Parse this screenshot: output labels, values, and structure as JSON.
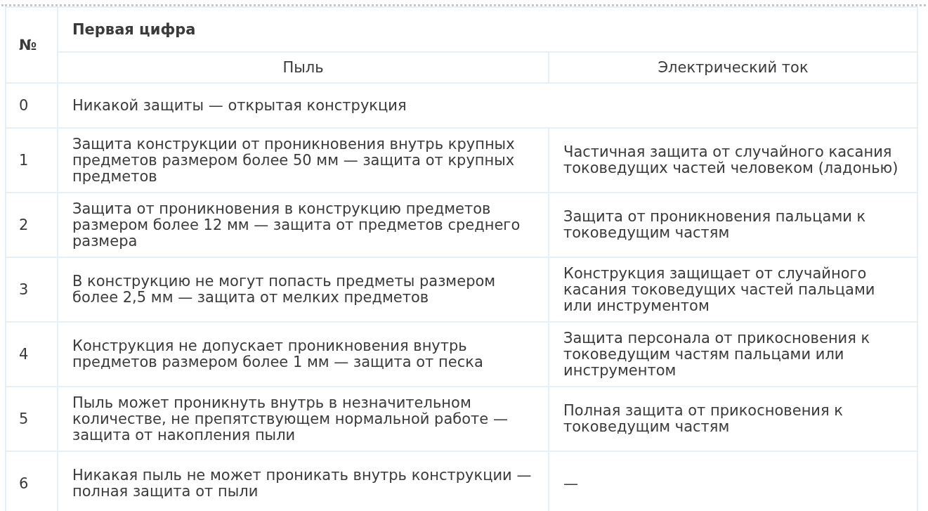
{
  "table": {
    "number_header": "№",
    "group_header": "Первая цифра",
    "columns": [
      "Пыль",
      "Электрический ток"
    ],
    "rows": [
      {
        "kind": "merged",
        "number": "0",
        "dust": "Никакой защиты — открытая конструкция"
      },
      {
        "kind": "split",
        "number": "1",
        "dust": "Защита конструкции от проникновения внутрь крупных предметов размером более 50 мм — защита от крупных предметов",
        "current": "Частичная защита от случайного касания токоведущих частей человеком (ладонью)"
      },
      {
        "kind": "split",
        "number": "2",
        "dust": "Защита от проникновения в конструкцию предметов размером более 12 мм — защита от предметов среднего размера",
        "current": "Защита от проникновения пальцами к токоведущим частям"
      },
      {
        "kind": "split",
        "number": "3",
        "dust": "В конструкцию не могут попасть предметы размером более 2,5 мм — защита от мелких предметов",
        "current": "Конструкция защищает от случайного касания токоведущих частей пальцами или инструментом"
      },
      {
        "kind": "split",
        "number": "4",
        "dust": "Конструкция не допускает проникновения внутрь предметов размером более 1 мм — защита от песка",
        "current": "Защита персонала от прикосновения к токоведущим частям пальцами или инструментом"
      },
      {
        "kind": "split",
        "number": "5",
        "dust": "Пыль может проникнуть внутрь в незначительном количестве, не препятствующем нормальной работе — защита от накопления пыли",
        "current": "Полная защита от прикосновения к токоведущим частям"
      },
      {
        "kind": "split",
        "number": "6",
        "dust": "Никакая пыль не может проникать внутрь конструкции — полная защита от пыли",
        "current": "—"
      }
    ]
  }
}
